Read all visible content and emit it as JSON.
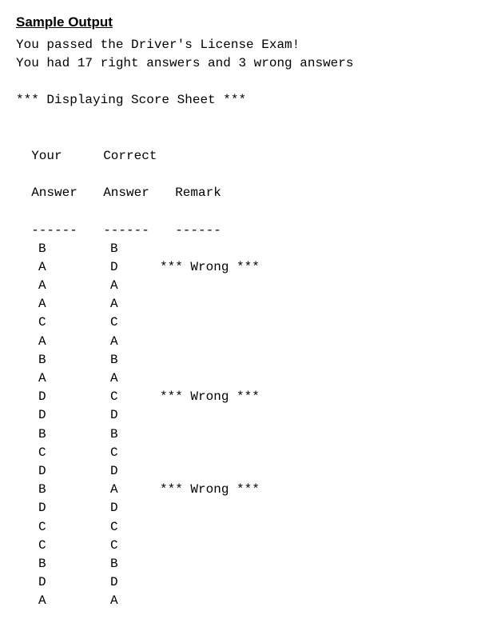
{
  "heading": "Sample Output",
  "pass_line": "You passed the Driver's License Exam!",
  "score_line": "You had 17 right answers and 3 wrong answers",
  "display_line": "*** Displaying Score Sheet ***",
  "headers": {
    "your_top": "Your",
    "your_bottom": "Answer",
    "correct_top": "Correct",
    "correct_bottom": "Answer",
    "remark": "Remark",
    "rule": "------"
  },
  "rows": [
    {
      "your": "B",
      "correct": "B",
      "remark": ""
    },
    {
      "your": "A",
      "correct": "D",
      "remark": "*** Wrong ***"
    },
    {
      "your": "A",
      "correct": "A",
      "remark": ""
    },
    {
      "your": "A",
      "correct": "A",
      "remark": ""
    },
    {
      "your": "C",
      "correct": "C",
      "remark": ""
    },
    {
      "your": "A",
      "correct": "A",
      "remark": ""
    },
    {
      "your": "B",
      "correct": "B",
      "remark": ""
    },
    {
      "your": "A",
      "correct": "A",
      "remark": ""
    },
    {
      "your": "D",
      "correct": "C",
      "remark": "*** Wrong ***"
    },
    {
      "your": "D",
      "correct": "D",
      "remark": ""
    },
    {
      "your": "B",
      "correct": "B",
      "remark": ""
    },
    {
      "your": "C",
      "correct": "C",
      "remark": ""
    },
    {
      "your": "D",
      "correct": "D",
      "remark": ""
    },
    {
      "your": "B",
      "correct": "A",
      "remark": "*** Wrong ***"
    },
    {
      "your": "D",
      "correct": "D",
      "remark": ""
    },
    {
      "your": "C",
      "correct": "C",
      "remark": ""
    },
    {
      "your": "C",
      "correct": "C",
      "remark": ""
    },
    {
      "your": "B",
      "correct": "B",
      "remark": ""
    },
    {
      "your": "D",
      "correct": "D",
      "remark": ""
    },
    {
      "your": "A",
      "correct": "A",
      "remark": ""
    }
  ]
}
